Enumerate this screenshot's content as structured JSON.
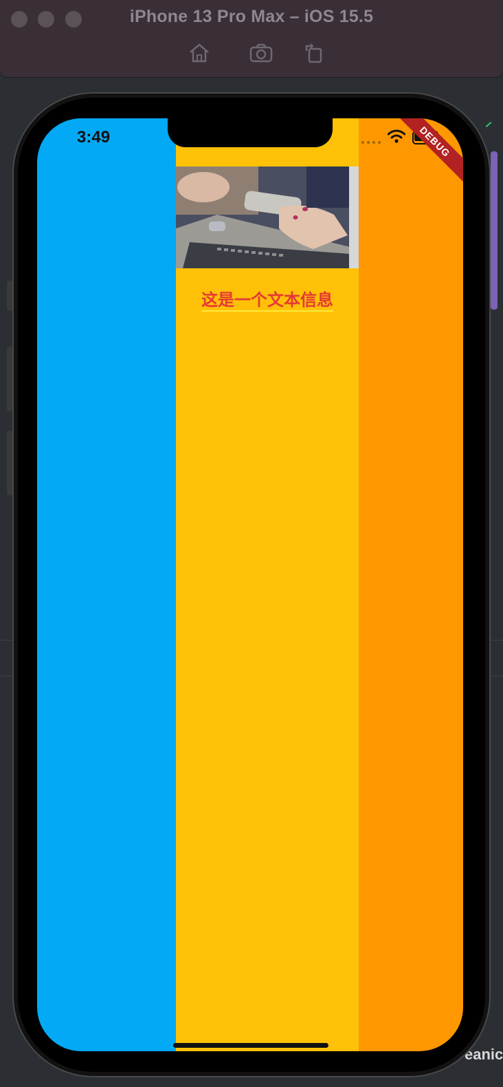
{
  "window": {
    "title": "iPhone 13 Pro Max – iOS 15.5",
    "toolbar": [
      "home-icon",
      "screenshot-icon",
      "rotate-icon"
    ]
  },
  "status_bar": {
    "time": "3:49"
  },
  "debug_banner": "DEBUG",
  "main": {
    "image_alt": "hands holding a smartphone over a laptop",
    "caption": "这是一个文本信息"
  },
  "colors": {
    "left_column": "#03a9f4",
    "middle_column": "#ffc107",
    "right_column": "#ff9800",
    "caption": "#e53935",
    "caption_underline": "#ffeb3b"
  },
  "ide": {
    "bottom_text": "eanic"
  }
}
